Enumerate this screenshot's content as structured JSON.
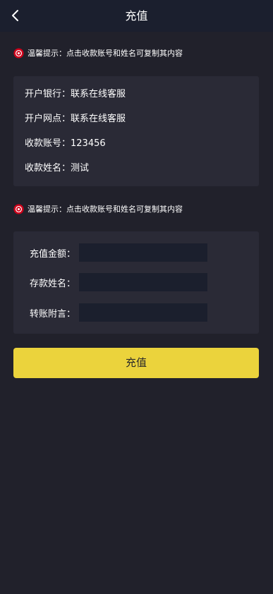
{
  "header": {
    "title": "充值",
    "back_icon": "chevron-left-icon"
  },
  "notice_top": {
    "icon": "warning-badge-icon",
    "text": "温馨提示：点击收款账号和姓名可复制其内容"
  },
  "bank_info": {
    "rows": [
      {
        "label": "开户银行：",
        "value": "联系在线客服"
      },
      {
        "label": "开户网点：",
        "value": "联系在线客服"
      },
      {
        "label": "收款账号：",
        "value": "123456"
      },
      {
        "label": "收款姓名：",
        "value": "测试"
      }
    ]
  },
  "notice_bottom": {
    "icon": "warning-badge-icon",
    "text": "温馨提示：点击收款账号和姓名可复制其内容"
  },
  "form": {
    "amount_label": "充值金额：",
    "amount_value": "",
    "depositor_label": "存款姓名：",
    "depositor_value": "",
    "remark_label": "转账附言：",
    "remark_value": ""
  },
  "submit": {
    "label": "充值"
  },
  "colors": {
    "background": "#21212b",
    "header": "#1b1f2e",
    "card": "#2a2a36",
    "input": "#1b1f2d",
    "accent": "#ebd33c",
    "notice_icon": "#d0021b"
  }
}
